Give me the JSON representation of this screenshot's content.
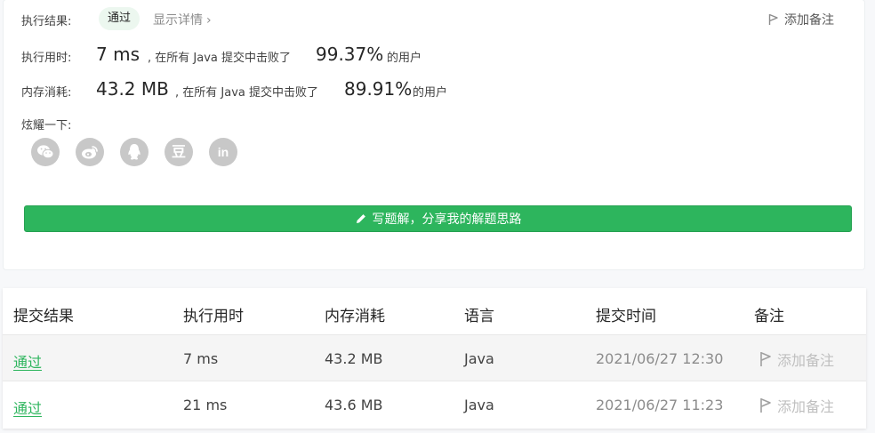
{
  "summary": {
    "result_label": "执行结果:",
    "result_status": "通过",
    "detail_link": "显示详情",
    "add_note": "添加备注",
    "runtime_label": "执行用时:",
    "runtime_value": "7 ms",
    "runtime_mid": ", 在所有 Java 提交中击败了",
    "runtime_percent": "99.37%",
    "runtime_suffix": "的用户",
    "memory_label": "内存消耗:",
    "memory_value": "43.2 MB",
    "memory_mid": ", 在所有 Java 提交中击败了",
    "memory_percent": "89.91%",
    "memory_suffix": "的用户",
    "share_label": "炫耀一下:",
    "share_icons": [
      "wechat-icon",
      "weibo-icon",
      "qq-icon",
      "douban-icon",
      "linkedin-icon"
    ],
    "douban_glyph": "豆",
    "linkedin_glyph": "in",
    "write_solution": "写题解，分享我的解题思路"
  },
  "table": {
    "headers": [
      "提交结果",
      "执行用时",
      "内存消耗",
      "语言",
      "提交时间",
      "备注"
    ],
    "rows": [
      {
        "result": "通过",
        "runtime": "7 ms",
        "memory": "43.2 MB",
        "language": "Java",
        "time": "2021/06/27 12:30",
        "note": "添加备注"
      },
      {
        "result": "通过",
        "runtime": "21 ms",
        "memory": "43.6 MB",
        "language": "Java",
        "time": "2021/06/27 11:23",
        "note": "添加备注"
      }
    ]
  },
  "colors": {
    "accent_green": "#2db55d",
    "pill_bg": "#ecf7ef",
    "share_grey": "#c8c8c8"
  }
}
